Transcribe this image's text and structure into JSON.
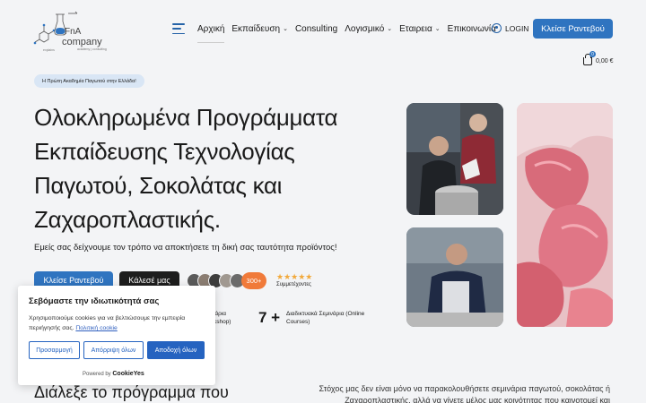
{
  "header": {
    "logo_text": "FnA company",
    "logo_subtext": "academy | consulting",
    "nav": [
      {
        "label": "Αρχική",
        "dropdown": false,
        "active": true
      },
      {
        "label": "Εκπαίδευση",
        "dropdown": true,
        "active": false
      },
      {
        "label": "Consulting",
        "dropdown": false,
        "active": false
      },
      {
        "label": "Λογισμικό",
        "dropdown": true,
        "active": false
      },
      {
        "label": "Εταιρεια",
        "dropdown": true,
        "active": false
      },
      {
        "label": "Επικοινωνία",
        "dropdown": false,
        "active": false
      }
    ],
    "login_label": "LOGIN",
    "cta_label": "Κλείσε Ραντεβού",
    "cart_total": "0,00 €",
    "cart_count": "0"
  },
  "hero": {
    "pill": "Η Πρώτη Ακαδημία Παγωτού στην Ελλάδα!",
    "title_lines": [
      "Ολοκληρωμένα Προγράμματα",
      "Εκπαίδευσης Τεχνολογίας",
      "Παγωτού, Σοκολάτας και",
      "Ζαχαροπλαστικής."
    ],
    "subtitle": "Εμείς σας δείχνουμε τον τρόπο να αποκτήσετε τη δική σας ταυτότητα προϊόντος!",
    "primary_button": "Κλείσε Ραντεβού",
    "secondary_button": "Κάλεσέ μας",
    "participants_count": "300+",
    "stars": "★★★★★",
    "participants_label": "Συμμετέχοντες",
    "stat1_label": "Σεμινάρια (Workshop)",
    "stat2_number": "7 +",
    "stat2_label": "Διαδικτυακά Σεμινάρια (Online Courses)"
  },
  "section": {
    "title": "Διάλεξε το πρόγραμμα που",
    "text": "Στόχος μας δεν είναι μόνο να παρακολουθήσετε σεμινάρια παγωτού, σοκολάτας ή Ζαχαροπλαστικής, αλλά να γίνετε μέλος μας κοινότητας που καινοτομεί και"
  },
  "cookie": {
    "title": "Σεβόμαστε την ιδιωτικότητά σας",
    "text": "Χρησιμοποιούμε cookies για να βελτιώσουμε την εμπειρία περιήγησής σας.",
    "policy_link": "Πολιτική cookie",
    "customize": "Προσαρμογή",
    "reject": "Απόρριψη όλων",
    "accept": "Αποδοχή όλων",
    "powered_by": "Powered by",
    "brand": "CookieYes"
  },
  "colors": {
    "accent": "#2f74c0",
    "dark_button": "#1d1d1d",
    "badge_orange": "#f07a3a",
    "stars": "#f2a93b",
    "pill_bg": "#d9e6f5"
  }
}
